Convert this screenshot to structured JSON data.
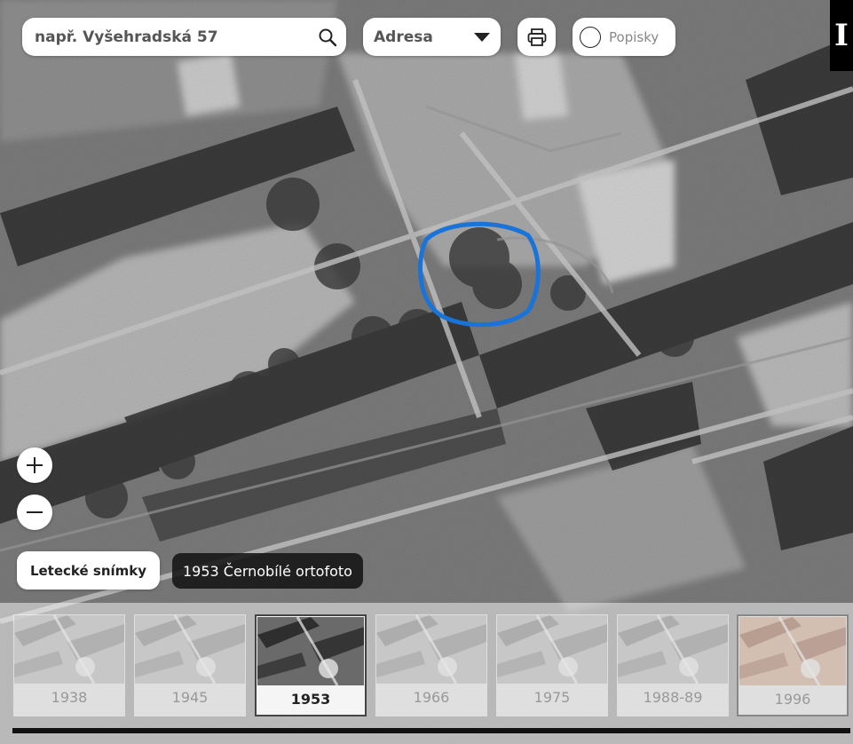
{
  "toolbar": {
    "search_placeholder": "např. Vyšehradská 57",
    "search_mode": "Adresa",
    "labels_toggle": "Popisky",
    "info_label": "I"
  },
  "layer": {
    "switch_button": "Letecké snímky",
    "current_layer": "1953 Černobílé ortofoto"
  },
  "timeline": {
    "years": [
      {
        "label": "1938",
        "selected": false
      },
      {
        "label": "1945",
        "selected": false
      },
      {
        "label": "1953",
        "selected": true
      },
      {
        "label": "1966",
        "selected": false
      },
      {
        "label": "1975",
        "selected": false
      },
      {
        "label": "1988-89",
        "selected": false
      },
      {
        "label": "1996",
        "selected": false
      }
    ]
  },
  "colors": {
    "annotation_circle": "#1a73d9",
    "ui_background": "#ffffff",
    "label_background": "#141414"
  },
  "icons": [
    "search-icon",
    "chevron-down-icon",
    "printer-icon",
    "plus-icon",
    "minus-icon",
    "info-icon"
  ]
}
